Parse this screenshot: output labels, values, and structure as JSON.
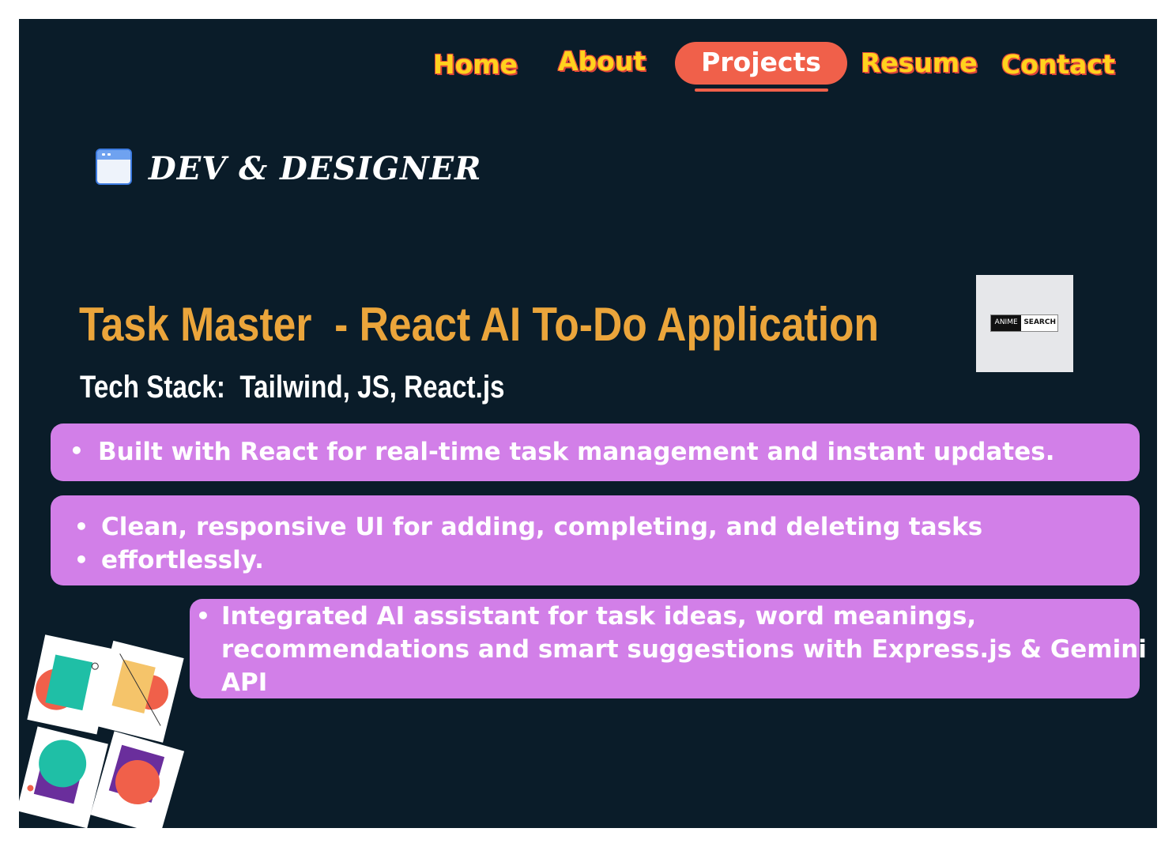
{
  "nav": {
    "items": [
      {
        "label": "Home"
      },
      {
        "label": "About"
      },
      {
        "label": "Projects",
        "active": true
      },
      {
        "label": "Resume"
      },
      {
        "label": "Contact"
      }
    ]
  },
  "brand": {
    "icon": "browser-window-icon",
    "title": "DEV & DESIGNER"
  },
  "project": {
    "title": "Task Master  - React AI To-Do Application",
    "tech_stack": "Tech Stack:  Tailwind, JS, React.js",
    "thumbnail": {
      "logo_left": "ANIME",
      "logo_right": "SEARCH"
    },
    "features": [
      {
        "lines": [
          "Built with React for real-time task management and instant updates."
        ]
      },
      {
        "lines": [
          "Clean, responsive UI for adding, completing, and deleting tasks",
          "effortlessly."
        ]
      },
      {
        "lines": [
          "Integrated AI assistant for task ideas, word meanings,",
          "recommendations and smart suggestions with Express.js & Gemini",
          "API"
        ]
      }
    ]
  },
  "colors": {
    "background": "#0a1c29",
    "nav_text": "#ffd21e",
    "nav_active": "#f0604a",
    "title": "#eba53b",
    "card": "#d27fe8"
  }
}
